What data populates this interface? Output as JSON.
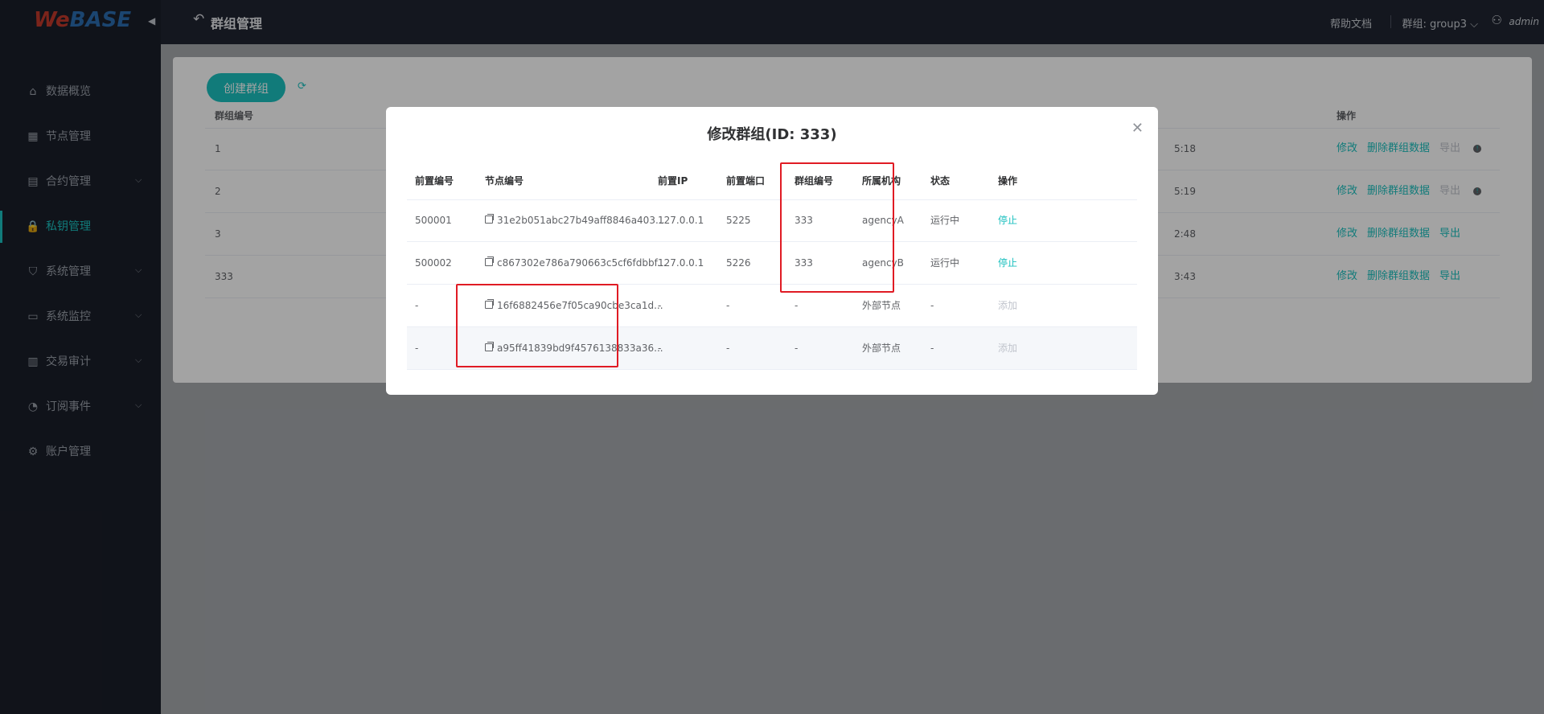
{
  "app": {
    "logo_we": "We",
    "logo_base": "BASE",
    "page_title": "群组管理",
    "help_label": "帮助文档",
    "group_selector": "群组: group3",
    "user": "admin"
  },
  "sidebar": {
    "items": [
      {
        "label": "数据概览",
        "icon": "home-icon",
        "has_children": false
      },
      {
        "label": "节点管理",
        "icon": "calendar-icon",
        "has_children": false
      },
      {
        "label": "合约管理",
        "icon": "clipboard-icon",
        "has_children": true
      },
      {
        "label": "私钥管理",
        "icon": "lock-icon",
        "has_children": false,
        "active": true
      },
      {
        "label": "系统管理",
        "icon": "shield-icon",
        "has_children": true
      },
      {
        "label": "系统监控",
        "icon": "monitor-icon",
        "has_children": true
      },
      {
        "label": "交易审计",
        "icon": "bar-chart-icon",
        "has_children": true
      },
      {
        "label": "订阅事件",
        "icon": "rss-icon",
        "has_children": true
      },
      {
        "label": "账户管理",
        "icon": "gear-icon",
        "has_children": false
      }
    ]
  },
  "main": {
    "create_button": "创建群组",
    "columns": {
      "group_id": "群组编号",
      "actions": "操作"
    },
    "rows": [
      {
        "group_id": "1",
        "time_fragment": "5:18",
        "modify": "修改",
        "delete": "删除群组数据",
        "export": "导出",
        "export_disabled": true
      },
      {
        "group_id": "2",
        "time_fragment": "5:19",
        "modify": "修改",
        "delete": "删除群组数据",
        "export": "导出",
        "export_disabled": true
      },
      {
        "group_id": "3",
        "time_fragment": "2:48",
        "modify": "修改",
        "delete": "删除群组数据",
        "export": "导出",
        "export_disabled": false
      },
      {
        "group_id": "333",
        "time_fragment": "3:43",
        "modify": "修改",
        "delete": "删除群组数据",
        "export": "导出",
        "export_disabled": false
      }
    ]
  },
  "modal": {
    "title": "修改群组(ID: 333)",
    "columns": [
      "前置编号",
      "节点编号",
      "前置IP",
      "前置端口",
      "群组编号",
      "所属机构",
      "状态",
      "操作"
    ],
    "rows": [
      {
        "front_id": "500001",
        "node_id": "31e2b051abc27b49aff8846a403...",
        "ip": "127.0.0.1",
        "port": "5225",
        "group_id": "333",
        "agency": "agencyA",
        "status": "运行中",
        "action": "停止",
        "action_enabled": true
      },
      {
        "front_id": "500002",
        "node_id": "c867302e786a790663c5cf6fdbbf...",
        "ip": "127.0.0.1",
        "port": "5226",
        "group_id": "333",
        "agency": "agencyB",
        "status": "运行中",
        "action": "停止",
        "action_enabled": true
      },
      {
        "front_id": "-",
        "node_id": "16f6882456e7f05ca90cbe3ca1d...",
        "ip": "-",
        "port": "-",
        "group_id": "-",
        "agency": "外部节点",
        "status": "-",
        "action": "添加",
        "action_enabled": false
      },
      {
        "front_id": "-",
        "node_id": "a95ff41839bd9f4576138833a36...",
        "ip": "-",
        "port": "-",
        "group_id": "-",
        "agency": "外部节点",
        "status": "-",
        "action": "添加",
        "action_enabled": false
      }
    ]
  },
  "colors": {
    "accent": "#1cc0bf",
    "sidebar_bg": "#1a1e29",
    "topbar_bg": "#202531",
    "highlight": "#e01b24"
  }
}
